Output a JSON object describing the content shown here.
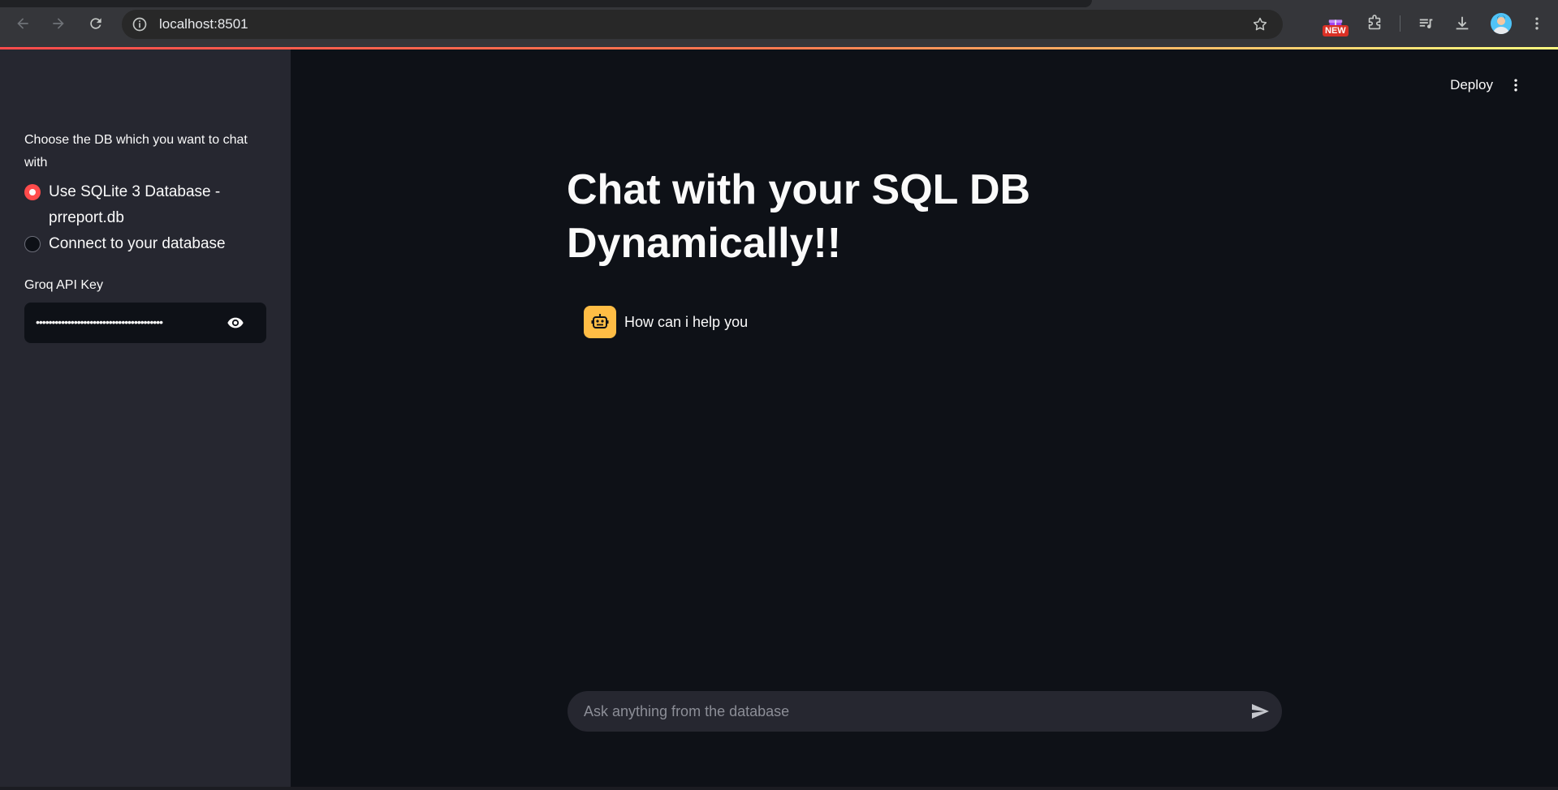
{
  "browser": {
    "url": "localhost:8501",
    "new_badge": "NEW"
  },
  "sidebar": {
    "db_choice_label": "Choose the DB which you want to chat with",
    "options": [
      {
        "label": "Use SQLite 3 Database - prreport.db",
        "selected": true
      },
      {
        "label": "Connect to your database",
        "selected": false
      }
    ],
    "api_key_label": "Groq API Key",
    "api_key_value": "••••••••••••••••••••••••••••••••••••••••"
  },
  "header": {
    "deploy_label": "Deploy"
  },
  "main": {
    "title": "Chat with your SQL DB Dynamically!!",
    "messages": [
      {
        "role": "assistant",
        "text": "How can i help you"
      }
    ],
    "chat_input_placeholder": "Ask anything from the database"
  },
  "colors": {
    "accent": "#ff4b4b",
    "assistant_avatar": "#ffbd45",
    "background": "#0e1117",
    "sidebar": "#262730"
  }
}
